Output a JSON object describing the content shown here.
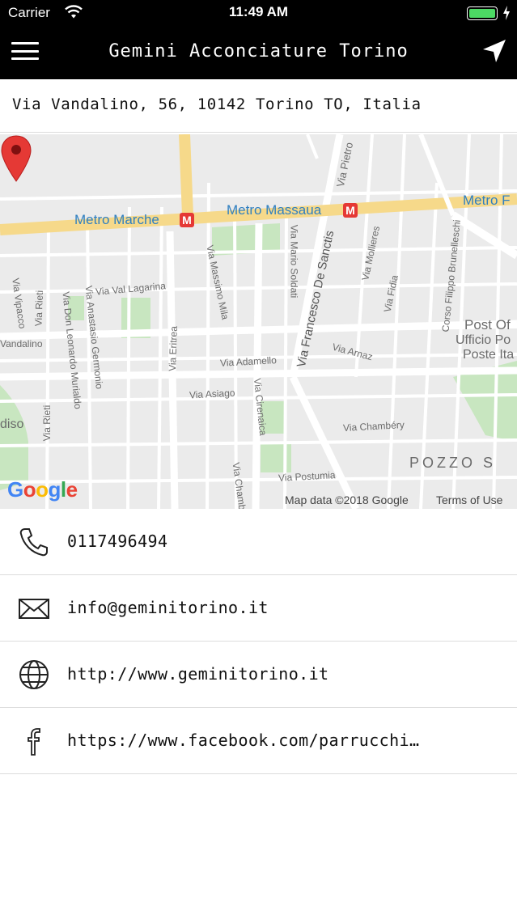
{
  "status_bar": {
    "carrier": "Carrier",
    "time": "11:49 AM",
    "battery_level": 1.0
  },
  "nav": {
    "title": "Gemini Acconciature Torino",
    "menu_icon": "hamburger-menu-icon",
    "locate_icon": "navigation-arrow-icon"
  },
  "address": {
    "text": "Via Vandalino, 56, 10142 Torino TO, Italia"
  },
  "map": {
    "labels": {
      "metro_marche": "Metro Marche",
      "metro_massaua": "Metro Massaua",
      "metro_right": "Metro F",
      "via_pietro": "Via Pietro",
      "via_mario_soldati": "Via Mario Soldati",
      "via_francesco_de_sanctis": "Via Francesco De Sanctis",
      "via_mollieres": "Via Mollieres",
      "via_fidia": "Via Fidia",
      "corso_filippo_brunelleschi": "Corso Filippo Brunelleschi",
      "via_val_lagarina": "Via Val Lagarina",
      "via_massimo_mila": "Via Massimo Mila",
      "via_vipacco": "Via Vipacco",
      "via_rieti": "Via Rieti",
      "via_don_leonardo_murialdo": "Via Don Leonardo Murialdo",
      "via_anastasio_germonio": "Via Anastasio Germonio",
      "via_eritrea": "Via Eritrea",
      "vandalino": "Vandalino",
      "via_adamello": "Via Adamello",
      "via_arnaz": "Via Arnaz",
      "via_asiago": "Via Asiago",
      "via_cirenaica": "Via Cirenaica",
      "via_chambery": "Via Chambéry",
      "via_rieti_2": "Via Rieti",
      "diso": "diso",
      "via_postumia": "Via Postumia",
      "via_chamb": "Via Chamb",
      "pozzo_s": "POZZO S",
      "post_of": "Post Of",
      "ufficio_po": "Ufficio Po",
      "poste_ita": "Poste Ita",
      "metro_icon": "M"
    },
    "google_logo": "Google",
    "attribution": "Map data ©2018 Google",
    "terms": "Terms of Use",
    "marker_icon": "map-pin-icon"
  },
  "contacts": [
    {
      "icon": "phone-icon",
      "text": "0117496494"
    },
    {
      "icon": "envelope-icon",
      "text": "info@geminitorino.it"
    },
    {
      "icon": "globe-icon",
      "text": "http://www.geminitorino.it"
    },
    {
      "icon": "facebook-icon",
      "text": "https://www.facebook.com/parrucchi…"
    }
  ]
}
